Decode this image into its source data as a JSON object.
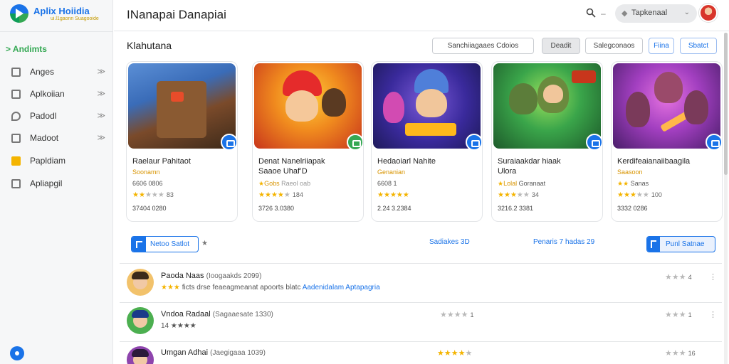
{
  "brand": {
    "title": "Aplix Hoiidia",
    "subtitle": "ui.l1gaonn Suagooide"
  },
  "sidebar": {
    "active_label": "Andimts",
    "items": [
      {
        "label": "Anges",
        "icon": "grid-icon",
        "arrow": "≫"
      },
      {
        "label": "Aplkoiian",
        "icon": "apps-icon",
        "arrow": "≫"
      },
      {
        "label": "Padodl",
        "icon": "tag-icon",
        "arrow": "≫"
      },
      {
        "label": "Madoot",
        "icon": "library-icon",
        "arrow": "≫"
      },
      {
        "label": "Papldiam",
        "icon": "book-icon",
        "arrow": ""
      },
      {
        "label": "Apliapgil",
        "icon": "building-icon",
        "arrow": ""
      }
    ]
  },
  "header": {
    "title": "INanapai Danapiai",
    "dash": "–",
    "account_label": "Tapkenaal",
    "account_caret": "⌄"
  },
  "section": {
    "title": "Klahutana",
    "filters": [
      "Sanchiiagaaes Cdoios",
      "Deadit",
      "Salegconaos",
      "Fiina",
      "Sbatct"
    ]
  },
  "cards": [
    {
      "title_lines": [
        "Raelaur Pahitaot"
      ],
      "subtitle": "Soonamn",
      "meta": "6606 0806",
      "stars": 2,
      "rating": "83",
      "size": "37404 0280",
      "badge_color": "#1a73e8"
    },
    {
      "title_lines": [
        "Denat Nanelriiapak",
        "Saaoe Uhaf’D"
      ],
      "subtitle": "Gobs",
      "meta": "Raeol oab",
      "stars": 4,
      "rating": "184",
      "size": "3726 3.0380",
      "badge_color": "#34a853"
    },
    {
      "title_lines": [
        "Hedaoiarl Nahite"
      ],
      "subtitle": "Genanian",
      "meta": "6608 1",
      "stars": 5,
      "rating": "",
      "size": "2.24 3.2384",
      "badge_color": "#1a73e8"
    },
    {
      "title_lines": [
        "Suraiaakdar hiaak",
        "Ulora"
      ],
      "subtitle": "Lolal",
      "meta": "Goranaat",
      "stars": 3,
      "rating": "34",
      "size": "3216.2 3381",
      "badge_color": "#1a73e8"
    },
    {
      "title_lines": [
        "Kerdifeaianaiibaagila"
      ],
      "subtitle": "Saasoon",
      "meta": "Sanas",
      "stars": 3,
      "rating": "100",
      "size": "3332 0286",
      "badge_color": "#1a73e8"
    }
  ],
  "mid": {
    "left_button": "Netoo Satlot",
    "star": "★",
    "link1": "Sadiakes  3D",
    "link2": "Penaris 7 hadas  29",
    "right_button": "Punl Satnae"
  },
  "list": [
    {
      "name": "Paoda Naas",
      "extra": "(Ioogaakds  2099)",
      "desc_stars": "★★★",
      "desc_text": "ficts drse feaeagmeanat apoorts blatc",
      "desc_link": "Aadenidalam  Aptapagria",
      "right_rating": "4",
      "right_stars": 3
    },
    {
      "name": "Vndoa Radaal",
      "extra": "(Sagaaesate  1330)",
      "sub": "14  ★★★★",
      "mid_stars": 4,
      "mid_rating": "1",
      "right_rating": "1",
      "right_stars": 3
    },
    {
      "name": "Umgan Adhai",
      "extra": "(Jaegigaaa  1039)",
      "mid_stars_gold": 5,
      "right_rating": "16",
      "right_stars": 3
    }
  ]
}
